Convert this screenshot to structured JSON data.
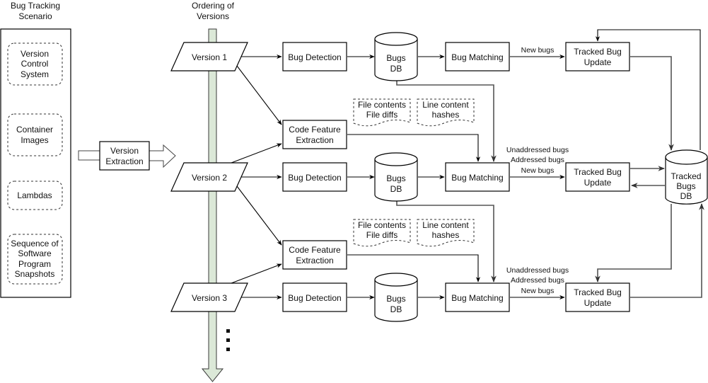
{
  "diagram": {
    "scenario": {
      "title_line1": "Bug Tracking",
      "title_line2": "Scenario",
      "items": [
        {
          "lines": [
            "Version",
            "Control",
            "System"
          ]
        },
        {
          "lines": [
            "Container",
            "Images"
          ]
        },
        {
          "lines": [
            "Lambdas"
          ]
        },
        {
          "lines": [
            "Sequence of",
            "Software",
            "Program",
            "Snapshots"
          ]
        }
      ]
    },
    "version_extraction": {
      "line1": "Version",
      "line2": "Extraction"
    },
    "ordering": {
      "title_line1": "Ordering of",
      "title_line2": "Versions",
      "ellipsis": "⋮"
    },
    "versions": [
      "Version 1",
      "Version 2",
      "Version 3"
    ],
    "bug_detection": "Bug Detection",
    "bugs_db": {
      "line1": "Bugs",
      "line2": "DB"
    },
    "bug_matching": "Bug Matching",
    "code_feature": {
      "line1": "Code Feature",
      "line2": "Extraction"
    },
    "doc_file": {
      "line1": "File contents",
      "line2": "File diffs"
    },
    "doc_hash": {
      "line1": "Line content",
      "line2": "hashes"
    },
    "tracked_update": {
      "line1": "Tracked Bug",
      "line2": "Update"
    },
    "tracked_db": {
      "line1": "Tracked",
      "line2": "Bugs",
      "line3": "DB"
    },
    "edge_labels": {
      "new_bugs": "New bugs",
      "unaddressed_bugs": "Unaddressed bugs",
      "addressed_bugs": "Addressed bugs"
    }
  }
}
